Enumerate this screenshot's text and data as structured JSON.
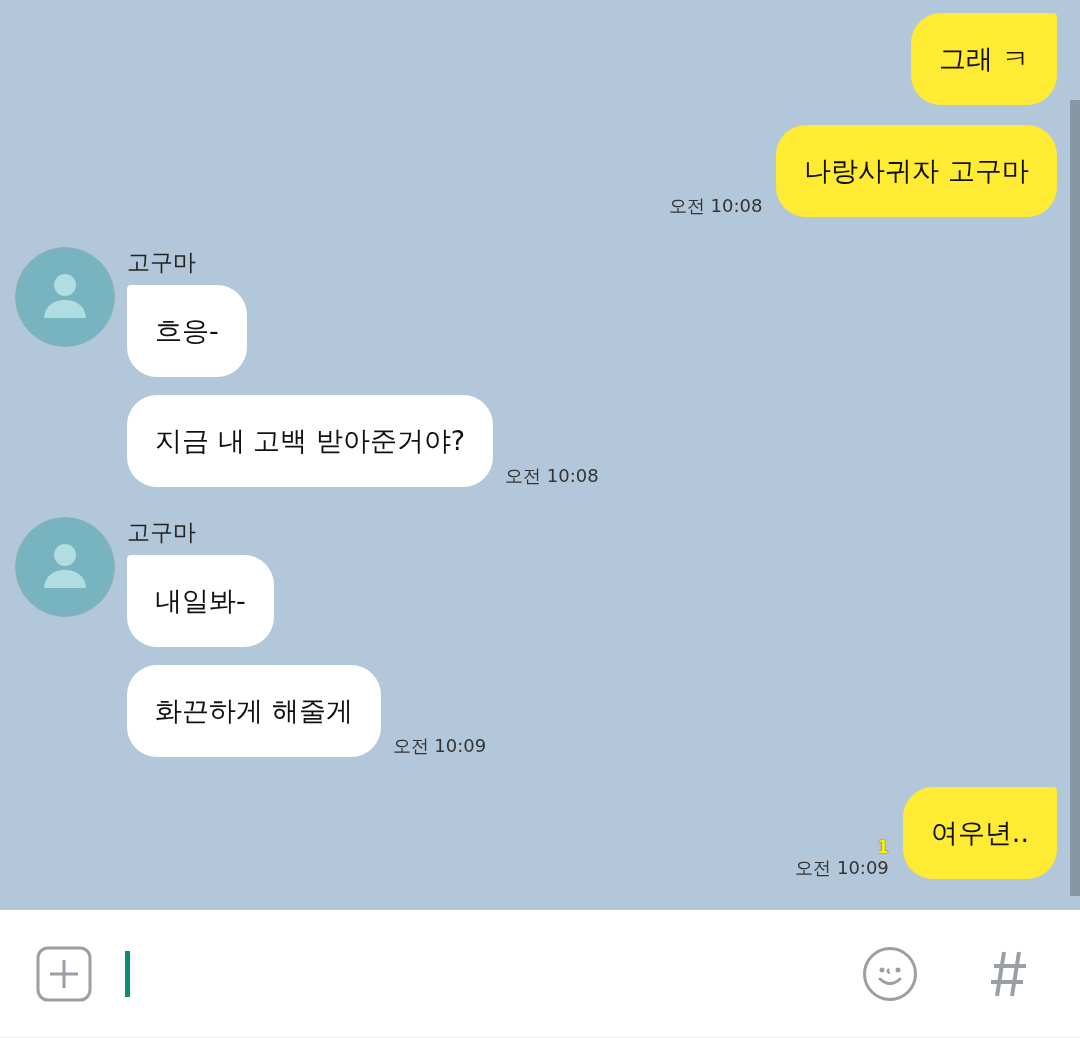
{
  "messages": [
    {
      "kind": "sent",
      "bubbles": [
        "그래 ㅋ",
        "나랑사귀자 고구마"
      ],
      "time": "오전 10:08"
    },
    {
      "kind": "received",
      "sender": "고구마",
      "bubbles": [
        "흐응-",
        "지금 내 고백 받아준거야?"
      ],
      "time": "오전 10:08"
    },
    {
      "kind": "received",
      "sender": "고구마",
      "bubbles": [
        "내일봐-",
        "화끈하게 해줄게"
      ],
      "time": "오전 10:09"
    },
    {
      "kind": "sent",
      "bubbles": [
        "여우년.."
      ],
      "unread": "1",
      "time": "오전 10:09"
    }
  ]
}
